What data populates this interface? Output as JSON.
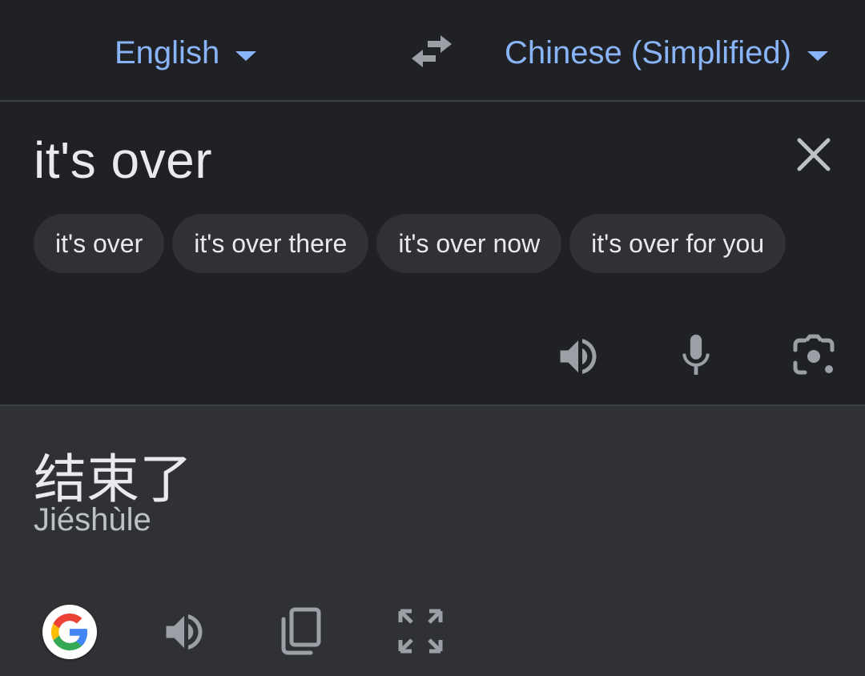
{
  "header": {
    "source_language": "English",
    "target_language": "Chinese (Simplified)"
  },
  "input": {
    "text": "it's over",
    "suggestions": [
      "it's over",
      "it's over there",
      "it's over now",
      "it's over for you"
    ]
  },
  "output": {
    "text": "结束了",
    "romanization": "Jiéshùle"
  },
  "icons": {
    "swap": "swap-languages-icon",
    "clear": "close-icon",
    "listen_input": "speaker-icon",
    "voice_input": "microphone-icon",
    "camera_input": "camera-icon",
    "google": "google-logo",
    "listen_output": "speaker-icon",
    "copy": "copy-icon",
    "fullscreen": "fullscreen-icon"
  },
  "colors": {
    "accent": "#8ab4f8",
    "background": "#202124",
    "output_background": "#303134",
    "chip": "#303134",
    "icon": "#9aa0a6"
  }
}
